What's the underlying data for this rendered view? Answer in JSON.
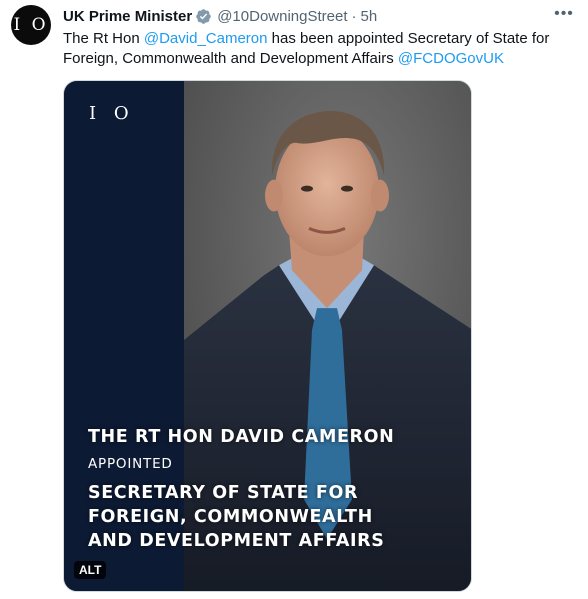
{
  "author": {
    "avatar_text": "I O",
    "display_name": "UK Prime Minister",
    "verified_icon": "verified-badge-gray",
    "handle": "@10DowningStreet",
    "separator": "·",
    "time": "5h"
  },
  "menu": {
    "more_label": "•••"
  },
  "tweet": {
    "text_part1": "The Rt Hon ",
    "mention1": "@David_Cameron",
    "text_part2": " has been appointed Secretary of State for Foreign, Commonwealth and Development Affairs ",
    "mention2": "@FCDOGovUK"
  },
  "media": {
    "logo_text": "I O",
    "caption_name": "THE RT HON DAVID CAMERON",
    "caption_appointed": "APPOINTED",
    "caption_role_line1": "SECRETARY OF STATE FOR",
    "caption_role_line2": "FOREIGN, COMMONWEALTH",
    "caption_role_line3": "AND DEVELOPMENT AFFAIRS",
    "alt_label": "ALT"
  },
  "colors": {
    "link": "#1d9bf0",
    "secondary_text": "#536471",
    "sidebar_navy": "#0d1a33"
  }
}
